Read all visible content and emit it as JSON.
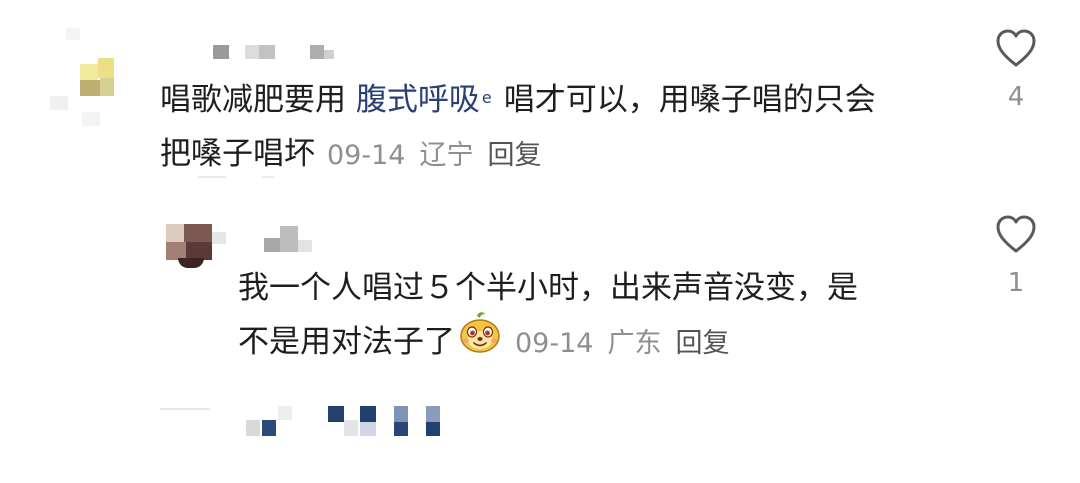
{
  "comments": [
    {
      "text_before": "唱歌减肥要用 ",
      "link_text": "腹式呼吸",
      "search_icon": "search-icon",
      "text_after_line1": "唱才可以，用嗓子唱的只会",
      "text_line2": "把嗓子唱坏",
      "date": "09-14",
      "location": "辽宁",
      "reply": "回复",
      "likes": "4",
      "like_icon": "heart-outline-icon"
    },
    {
      "text_line1": "我一个人唱过５个半小时，出来声音没变，是",
      "text_line2": "不是用对法子了",
      "emoji": "smiling-creature-emoji",
      "date": "09-14",
      "location": "广东",
      "reply": "回复",
      "likes": "1",
      "like_icon": "heart-outline-icon"
    }
  ],
  "colors": {
    "text": "#1e1e1e",
    "link": "#2a3f76",
    "meta": "#8e8e93",
    "icon": "#5a5a5a"
  }
}
